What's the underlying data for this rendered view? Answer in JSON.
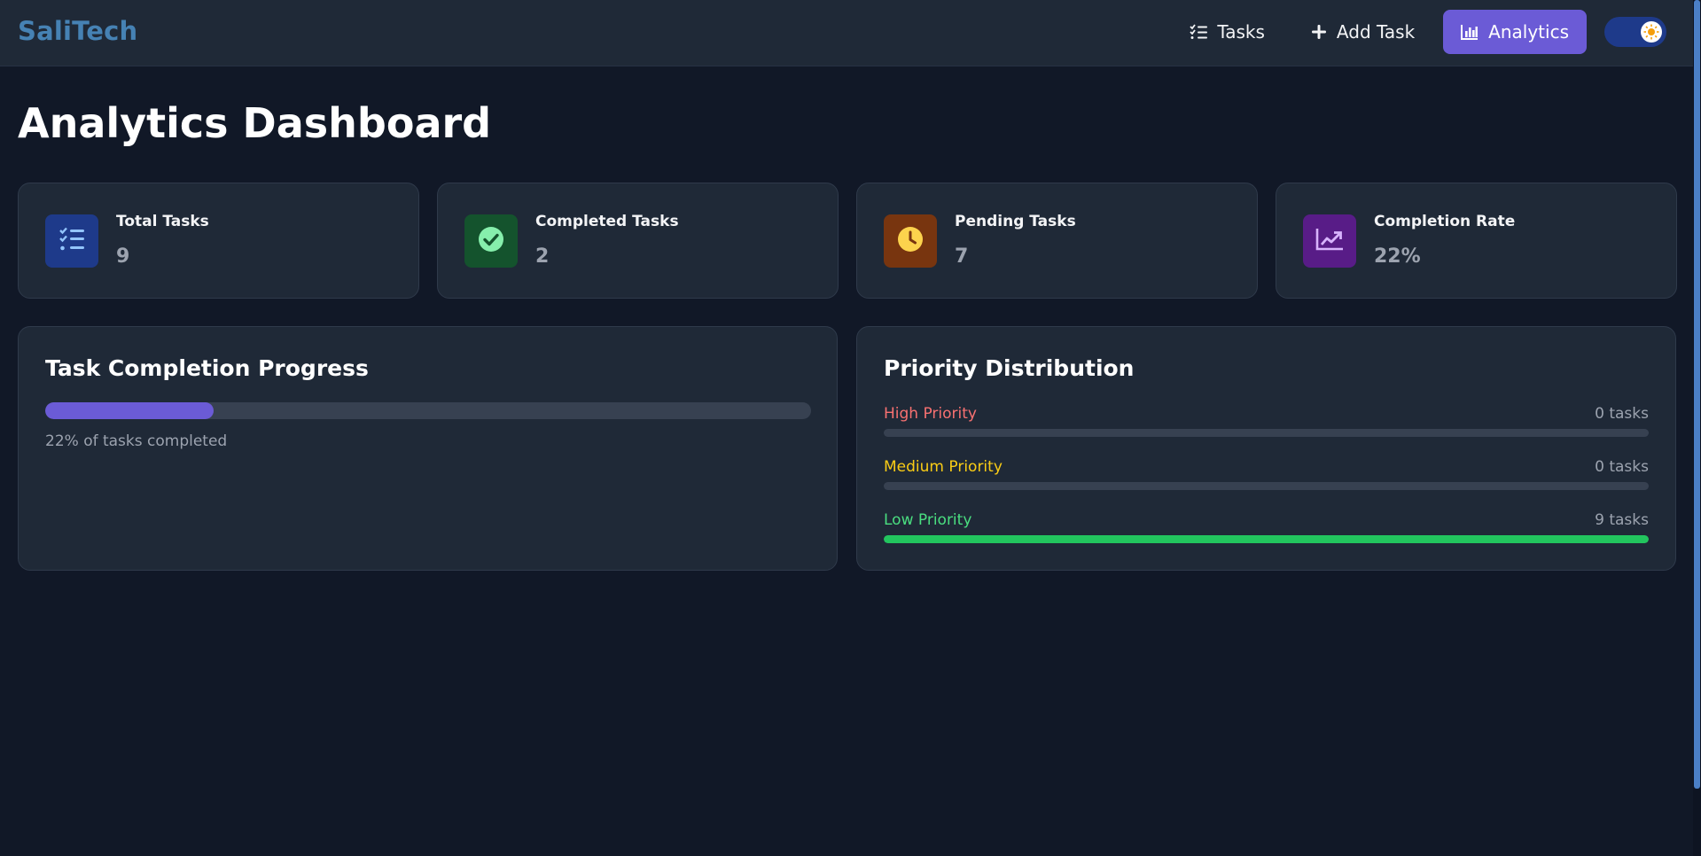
{
  "app": {
    "brand": "SaliTech"
  },
  "nav": {
    "tasks_label": "Tasks",
    "add_task_label": "Add Task",
    "analytics_label": "Analytics",
    "theme_toggle": "light-mode"
  },
  "page": {
    "title": "Analytics Dashboard"
  },
  "stats": [
    {
      "label": "Total Tasks",
      "value": "9",
      "icon": "list-check-icon",
      "bg": "#1e3a8a",
      "fg": "#93c5fd"
    },
    {
      "label": "Completed Tasks",
      "value": "2",
      "icon": "check-circle-icon",
      "bg": "#14532d",
      "fg": "#86efac"
    },
    {
      "label": "Pending Tasks",
      "value": "7",
      "icon": "clock-icon",
      "bg": "#78350f",
      "fg": "#fcd34d"
    },
    {
      "label": "Completion Rate",
      "value": "22%",
      "icon": "trend-chart-icon",
      "bg": "#581c87",
      "fg": "#d8b4fe"
    }
  ],
  "completion": {
    "title": "Task Completion Progress",
    "percent": 22,
    "caption": "22% of tasks completed"
  },
  "priority": {
    "title": "Priority Distribution",
    "items": [
      {
        "label": "High Priority",
        "count_text": "0 tasks",
        "fraction": 0,
        "color": "#f87171",
        "bar": "#ef4444"
      },
      {
        "label": "Medium Priority",
        "count_text": "0 tasks",
        "fraction": 0,
        "color": "#facc15",
        "bar": "#eab308"
      },
      {
        "label": "Low Priority",
        "count_text": "9 tasks",
        "fraction": 1,
        "color": "#4ade80",
        "bar": "#22c55e"
      }
    ]
  },
  "colors": {
    "accent": "#6b5bd6",
    "brand": "#4682b4",
    "background": "#111827",
    "card": "#1f2937"
  }
}
